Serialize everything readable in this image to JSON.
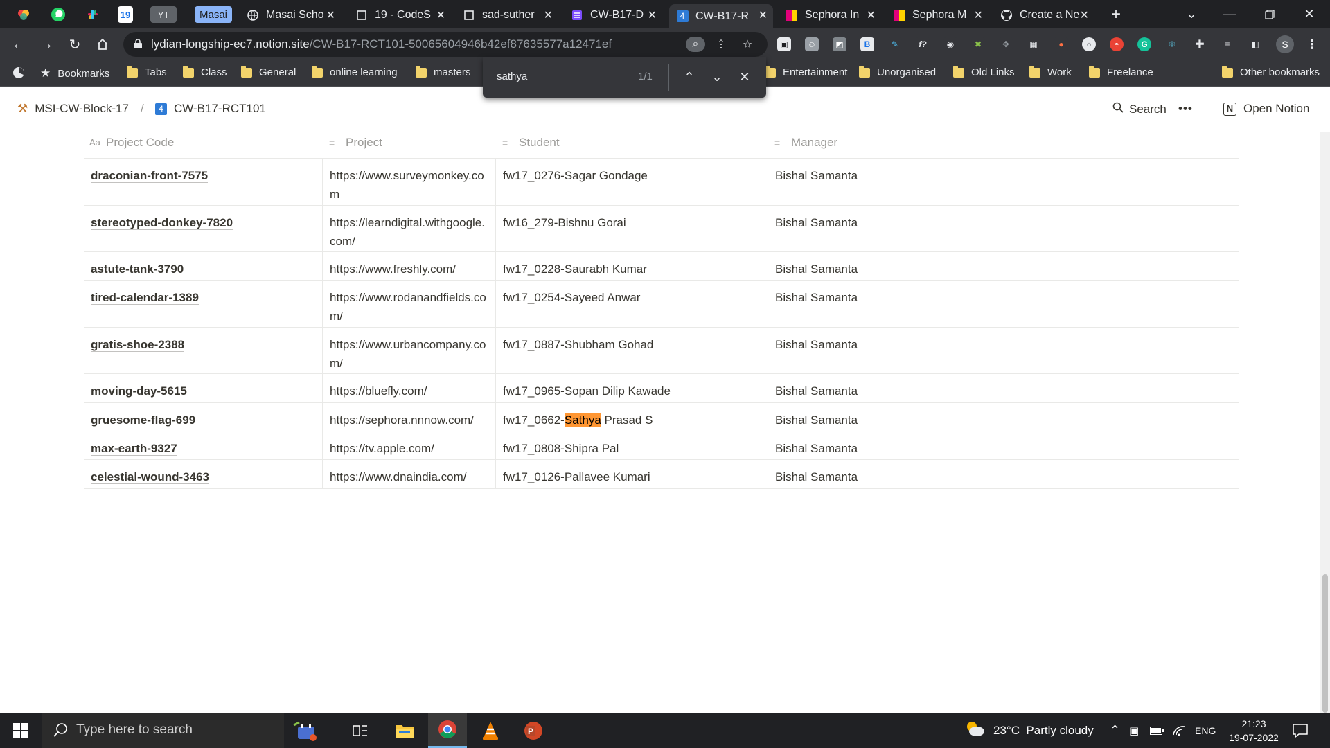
{
  "browser": {
    "pinned_tabs": [
      {
        "name": "colorful-app-icon",
        "label": ""
      },
      {
        "name": "whatsapp-icon",
        "label": ""
      },
      {
        "name": "slack-icon",
        "label": ""
      },
      {
        "name": "calendar-icon",
        "label": "19"
      },
      {
        "name": "yt-tab",
        "label": "YT"
      },
      {
        "name": "masai-group",
        "label": "Masai"
      }
    ],
    "tabs": [
      {
        "title": "Masai Scho",
        "icon": "globe-icon",
        "active": false
      },
      {
        "title": "19 - CodeS",
        "icon": "square-icon",
        "active": false
      },
      {
        "title": "sad-suther",
        "icon": "square-icon",
        "active": false
      },
      {
        "title": "CW-B17-D",
        "icon": "notion-db-icon",
        "active": false
      },
      {
        "title": "CW-B17-R",
        "icon": "number-4-icon",
        "active": true
      },
      {
        "title": "Sephora In",
        "icon": "sephora-icon",
        "active": false
      },
      {
        "title": "Sephora M",
        "icon": "sephora-icon",
        "active": false
      },
      {
        "title": "Create a Ne",
        "icon": "github-icon",
        "active": false
      }
    ],
    "url_host": "lydian-longship-ec7.notion.site",
    "url_path": "/CW-B17-RCT101-50065604946b42ef87635577a12471ef",
    "profile_initial": "S",
    "bookmarks": [
      {
        "label": "Bookmarks",
        "icon": "star-icon"
      },
      {
        "label": "Tabs"
      },
      {
        "label": "Class"
      },
      {
        "label": "General"
      },
      {
        "label": "online learning"
      },
      {
        "label": "masters"
      },
      {
        "label": "Entertainment"
      },
      {
        "label": "Unorganised"
      },
      {
        "label": "Old Links"
      },
      {
        "label": "Work"
      },
      {
        "label": "Freelance"
      },
      {
        "label": "Other bookmarks"
      }
    ],
    "find": {
      "query": "sathya",
      "count": "1/1"
    }
  },
  "notion": {
    "breadcrumb": [
      "MSI-CW-Block-17",
      "CW-B17-RCT101"
    ],
    "breadcrumb_sep": "/",
    "page_icon_label": "4",
    "search_label": "Search",
    "more_label": "•••",
    "open_notion_label": "Open Notion"
  },
  "table": {
    "columns": [
      "Project Code",
      "Project",
      "Student",
      "Manager"
    ],
    "rows": [
      {
        "code": "draconian-front-7575",
        "project": "https://www.surveymonkey.com",
        "student": "fw17_0276-Sagar Gondage",
        "manager": "Bishal Samanta"
      },
      {
        "code": "stereotyped-donkey-7820",
        "project": "https://learndigital.withgoogle.com/",
        "student": "fw16_279-Bishnu Gorai",
        "manager": "Bishal Samanta"
      },
      {
        "code": "astute-tank-3790",
        "project": "https://www.freshly.com/",
        "student": "fw17_0228-Saurabh Kumar",
        "manager": "Bishal Samanta"
      },
      {
        "code": "tired-calendar-1389",
        "project": "https://www.rodanandfields.com/",
        "student": "fw17_0254-Sayeed Anwar",
        "manager": "Bishal Samanta"
      },
      {
        "code": "gratis-shoe-2388",
        "project": "https://www.urbancompany.com/",
        "student": "fw17_0887-Shubham Gohad",
        "manager": "Bishal Samanta"
      },
      {
        "code": "moving-day-5615",
        "project": "https://bluefly.com/",
        "student": "fw17_0965-Sopan Dilip Kawade",
        "manager": "Bishal Samanta"
      },
      {
        "code": "gruesome-flag-699",
        "project": "https://sephora.nnnow.com/",
        "student_pre": "fw17_0662-",
        "student_hl": "Sathya",
        "student_post": " Prasad S",
        "manager": "Bishal Samanta"
      },
      {
        "code": "max-earth-9327",
        "project": "https://tv.apple.com/",
        "student": "fw17_0808-Shipra Pal",
        "manager": "Bishal Samanta"
      },
      {
        "code": "celestial-wound-3463",
        "project": "https://www.dnaindia.com/",
        "student": "fw17_0126-Pallavee Kumari",
        "manager": "Bishal Samanta"
      }
    ]
  },
  "taskbar": {
    "search_placeholder": "Type here to search",
    "weather": "23°C  Partly cloudy",
    "lang": "ENG",
    "time": "21:23",
    "date": "19-07-2022"
  }
}
